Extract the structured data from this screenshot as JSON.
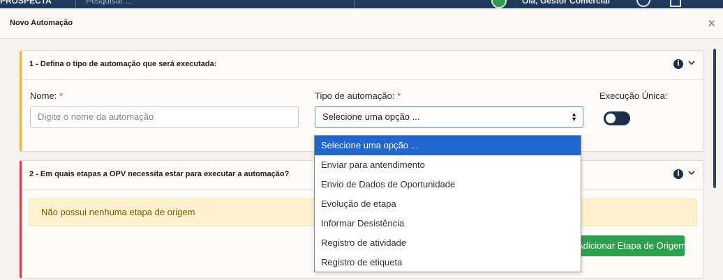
{
  "app": {
    "brand": "PROSPECTA",
    "search_placeholder": "Pesquisar ...",
    "greeting": "Olá, Gestor Comercial"
  },
  "modal": {
    "title": "Novo Automação",
    "close_label": "×"
  },
  "section1": {
    "title": "1 - Defina o tipo de automação que será executada:",
    "name_label": "Nome:",
    "name_placeholder": "Digite o nome da automação",
    "type_label": "Tipo de automação:",
    "type_selected": "Selecione uma opção ...",
    "unique_label": "Execução Única:",
    "unique_toggle_on": false
  },
  "section2": {
    "title": "2 - Em quais etapas a OPV necessita estar para executar a automação?",
    "empty_message": "Não possui nenhuma etapa de origem",
    "add_button": "Adicionar Etapa de Origem"
  },
  "dropdown": {
    "options": [
      "Selecione uma opção ...",
      "Enviar para antendimento",
      "Envio de Dados de Oportunidade",
      "Evolução de etapa",
      "Informar Desistência",
      "Registro de atividade",
      "Registro de etiqueta"
    ],
    "selected_index": 0
  },
  "colors": {
    "section1_accent": "#f2b33d",
    "section2_accent": "#e03c3c",
    "primary_dark": "#1b2f4a",
    "button_green": "#2ea04d",
    "option_highlight": "#1f66d1"
  },
  "icons": {
    "info": "info-icon",
    "chevron": "chevron-down-icon",
    "close": "close-icon",
    "select_arrow": "sort-arrows-icon"
  }
}
